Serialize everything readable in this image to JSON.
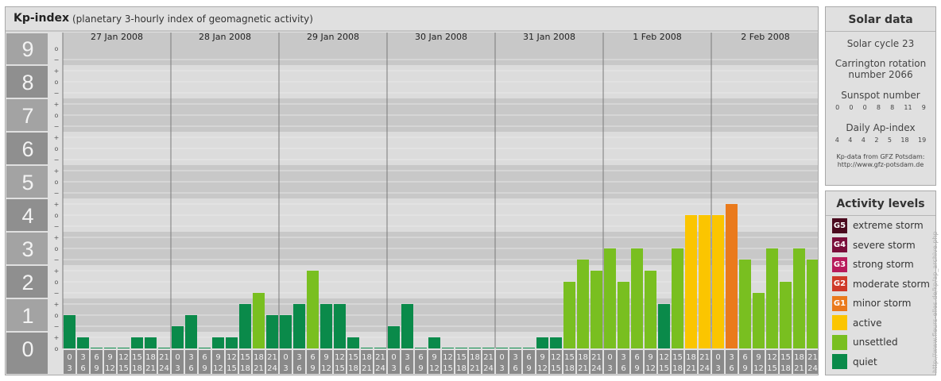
{
  "header": {
    "title": "Kp-index",
    "subtitle": "(planetary 3-hourly index of geomagnetic activity)"
  },
  "chart_data": {
    "type": "bar",
    "title": "Kp-index",
    "subtitle": "(planetary 3-hourly index of geomagnetic activity)",
    "ylim": [
      0,
      9
    ],
    "y_ticks": [
      "0",
      "1",
      "2",
      "3",
      "4",
      "5",
      "6",
      "7",
      "8",
      "9"
    ],
    "minor_ticks": [
      "o",
      "+",
      "−"
    ],
    "days": [
      "27 Jan 2008",
      "28 Jan 2008",
      "29 Jan 2008",
      "30 Jan 2008",
      "31 Jan 2008",
      "1 Feb 2008",
      "2 Feb 2008"
    ],
    "interval_labels": [
      [
        "0",
        "3"
      ],
      [
        "3",
        "6"
      ],
      [
        "6",
        "9"
      ],
      [
        "9",
        "12"
      ],
      [
        "12",
        "15"
      ],
      [
        "15",
        "18"
      ],
      [
        "18",
        "21"
      ],
      [
        "21",
        "24"
      ]
    ],
    "values": [
      [
        1.0,
        0.333,
        0.0,
        0.0,
        0.0,
        0.333,
        0.333,
        0.0
      ],
      [
        0.667,
        1.0,
        0.0,
        0.333,
        0.333,
        1.333,
        1.667,
        1.0
      ],
      [
        1.0,
        1.333,
        2.333,
        1.333,
        1.333,
        0.333,
        0.0,
        0.0
      ],
      [
        0.667,
        1.333,
        0.0,
        0.333,
        0.0,
        0.0,
        0.0,
        0.0
      ],
      [
        0.0,
        0.0,
        0.0,
        0.333,
        0.333,
        2.0,
        2.667,
        2.333
      ],
      [
        3.0,
        2.0,
        3.0,
        2.333,
        1.333,
        3.0,
        4.0,
        4.0
      ],
      [
        4.0,
        4.333,
        2.667,
        1.667,
        3.0,
        2.0,
        3.0,
        2.667
      ]
    ],
    "grid": true
  },
  "colors": {
    "quiet": "#0a8a4a",
    "unsettled": "#79bf20",
    "active": "#fbc500",
    "minor_storm": "#ea7a1c",
    "moderate_storm": "#cf3a28",
    "strong_storm": "#b81b5b",
    "severe_storm": "#7a0e3a",
    "extreme_storm": "#4a0a1e"
  },
  "solar": {
    "heading": "Solar data",
    "cycle": "Solar cycle 23",
    "carrington_line1": "Carrington rotation",
    "carrington_line2": "number 2066",
    "sunspot_label": "Sunspot number",
    "sunspot_values": [
      "0",
      "0",
      "0",
      "8",
      "8",
      "11",
      "9"
    ],
    "ap_label": "Daily Ap-index",
    "ap_values": [
      "4",
      "4",
      "4",
      "2",
      "5",
      "18",
      "19"
    ],
    "source_line1": "Kp-data from GFZ Potsdam:",
    "source_line2": "http://www.gfz-potsdam.de"
  },
  "activity": {
    "heading": "Activity levels",
    "levels": [
      {
        "code": "G5",
        "label": "extreme storm",
        "color": "#4a0a1e"
      },
      {
        "code": "G4",
        "label": "severe storm",
        "color": "#7a0e3a"
      },
      {
        "code": "G3",
        "label": "strong storm",
        "color": "#b81b5b"
      },
      {
        "code": "G2",
        "label": "moderate storm",
        "color": "#cf3a28"
      },
      {
        "code": "G1",
        "label": "minor storm",
        "color": "#ea7a1c"
      },
      {
        "code": "",
        "label": "active",
        "color": "#fbc500"
      },
      {
        "code": "",
        "label": "unsettled",
        "color": "#79bf20"
      },
      {
        "code": "",
        "label": "quiet",
        "color": "#0a8a4a"
      }
    ]
  },
  "credit": "http://www.fleurs-elles.de/kp/ap_archive.php"
}
